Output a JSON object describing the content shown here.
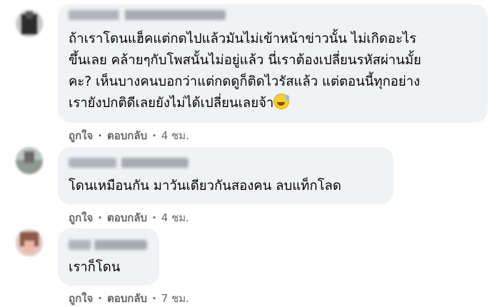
{
  "comments": [
    {
      "author": "",
      "lines": [
        "ถ้าเราโดนแฮ็คแต่กดไปแล้วมันไม่เข้าหน้าข่าวนั้น ไม่เกิดอะไร",
        "ขึ้นเลย คล้ายๆกับโพสนั้นไม่อยู่แล้ว นี่เราต้องเปลี่ยนรหัสผ่านมั้ย",
        "คะ? เห็นบางคนบอกว่าแต่กดดูก็ติดไวรัสแล้ว แต่ตอนนี้ทุกอย่าง",
        "เรายังปกติดีเลยยังไม่ได้เปลี่ยนเลยจ้า"
      ],
      "emoji": "grinning-sweat-emoji",
      "like_label": "ถูกใจ",
      "reply_label": "ตอบกลับ",
      "time": "4 ชม."
    },
    {
      "author": "",
      "lines": [
        "โดนเหมือนกัน มาวันเดียวกันสองคน ลบแท็กโลด"
      ],
      "like_label": "ถูกใจ",
      "reply_label": "ตอบกลับ",
      "time": "4 ชม."
    },
    {
      "author": "",
      "lines": [
        "เราก็โดน"
      ],
      "like_label": "ถูกใจ",
      "reply_label": "ตอบกลับ",
      "time": "7 ชม."
    }
  ],
  "separator": "·",
  "colors": {
    "bubble": "#f0f2f5",
    "meta": "#65676b",
    "text": "#050505"
  }
}
